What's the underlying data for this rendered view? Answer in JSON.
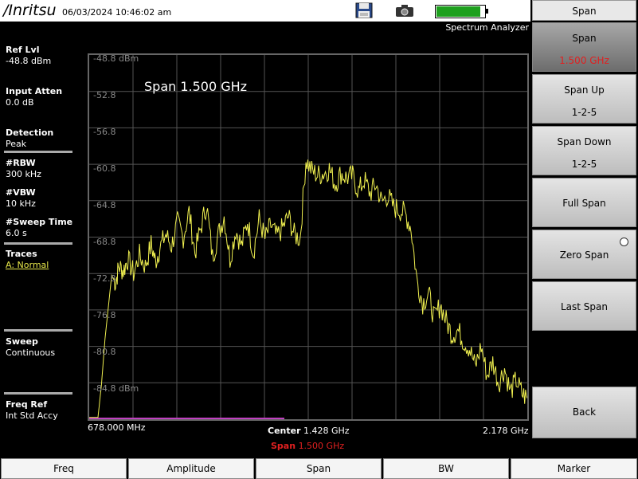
{
  "header": {
    "logo": "/Inritsu",
    "datetime": "06/03/2024 10:46:02 am",
    "mode": "Spectrum Analyzer",
    "battery_level": 0.95,
    "battery_color": "#1ea01e",
    "icons": [
      "save-icon",
      "camera-icon",
      "battery-icon"
    ]
  },
  "left_panel": {
    "ref_lvl_label": "Ref Lvl",
    "ref_lvl_value": "-48.8 dBm",
    "input_atten_label": "Input Atten",
    "input_atten_value": "0.0 dB",
    "detection_label": "Detection",
    "detection_value": "Peak",
    "rbw_label": "#RBW",
    "rbw_value": "300 kHz",
    "vbw_label": "#VBW",
    "vbw_value": "10 kHz",
    "sweep_time_label": "#Sweep Time",
    "sweep_time_value": "6.0 s",
    "traces_label": "Traces",
    "traces_value": "A: Normal",
    "sweep_label": "Sweep",
    "sweep_value": "Continuous",
    "freq_ref_label": "Freq Ref",
    "freq_ref_value": "Int Std Accy"
  },
  "graph": {
    "overlay_text": "Span 1.500 GHz",
    "y_ticks": [
      "-48.8 dBm",
      "-52.8",
      "-56.8",
      "-60.8",
      "-64.8",
      "-68.8",
      "-72.8",
      "-76.8",
      "-80.8",
      "-84.8 dBm"
    ],
    "start_freq": "678.000 MHz",
    "center_label": "Center",
    "center_value": "1.428 GHz",
    "span_label": "Span",
    "span_value": "1.500 GHz",
    "stop_freq": "2.178 GHz",
    "trace_color": "#f0f050"
  },
  "chart_data": {
    "type": "line",
    "title": "",
    "xlabel": "",
    "ylabel": "",
    "xlim": [
      678,
      2178
    ],
    "ylim": [
      -88.8,
      -48.8
    ],
    "series": [
      {
        "x": [
          678,
          708,
          720,
          732,
          745,
          755,
          768,
          780,
          795,
          810,
          830,
          850,
          870,
          890,
          905,
          920,
          940,
          960,
          980,
          1000,
          1020,
          1040,
          1060,
          1080,
          1100,
          1120,
          1140,
          1160,
          1180,
          1200,
          1220,
          1240,
          1260,
          1280,
          1300,
          1320,
          1340,
          1360,
          1380,
          1400,
          1420,
          1440,
          1460,
          1480,
          1500,
          1520,
          1540,
          1560,
          1580,
          1600,
          1620,
          1640,
          1660,
          1680,
          1700,
          1720,
          1740,
          1760,
          1780,
          1800,
          1820,
          1840,
          1860,
          1880,
          1900,
          1920,
          1940,
          1960,
          1980,
          2000,
          2020,
          2040,
          2060,
          2080,
          2100,
          2120,
          2140,
          2160,
          2178
        ],
        "values": [
          -88.6,
          -88.6,
          -85.0,
          -80.0,
          -76.0,
          -73.0,
          -73.8,
          -72.0,
          -72.5,
          -71.2,
          -72.8,
          -70.8,
          -72.0,
          -69.6,
          -71.5,
          -70.0,
          -68.5,
          -69.8,
          -67.2,
          -68.8,
          -66.0,
          -70.5,
          -67.8,
          -65.2,
          -71.0,
          -68.5,
          -66.5,
          -71.2,
          -68.0,
          -69.8,
          -67.0,
          -70.5,
          -66.8,
          -69.0,
          -67.5,
          -68.8,
          -67.8,
          -66.5,
          -68.5,
          -69.0,
          -60.3,
          -61.5,
          -62.0,
          -61.8,
          -61.3,
          -63.0,
          -61.8,
          -62.3,
          -62.1,
          -63.8,
          -62.5,
          -64.0,
          -63.0,
          -65.0,
          -64.2,
          -65.5,
          -65.8,
          -66.2,
          -67.8,
          -73.5,
          -76.0,
          -75.0,
          -77.8,
          -76.2,
          -78.0,
          -79.5,
          -79.0,
          -80.2,
          -81.0,
          -83.0,
          -80.8,
          -84.0,
          -82.5,
          -84.8,
          -83.2,
          -85.8,
          -84.5,
          -86.0,
          -86.5
        ]
      }
    ]
  },
  "right_menu": {
    "title": "Span",
    "buttons": [
      {
        "l1": "Span",
        "l2": "1.500 GHz"
      },
      {
        "l1": "Span Up",
        "l2": "1-2-5"
      },
      {
        "l1": "Span Down",
        "l2": "1-2-5"
      },
      {
        "l1": "Full Span"
      },
      {
        "l1": "Zero Span"
      },
      {
        "l1": "Last Span"
      },
      {
        "l1": "Back"
      }
    ]
  },
  "bottom_tabs": [
    "Freq",
    "Amplitude",
    "Span",
    "BW",
    "Marker"
  ]
}
